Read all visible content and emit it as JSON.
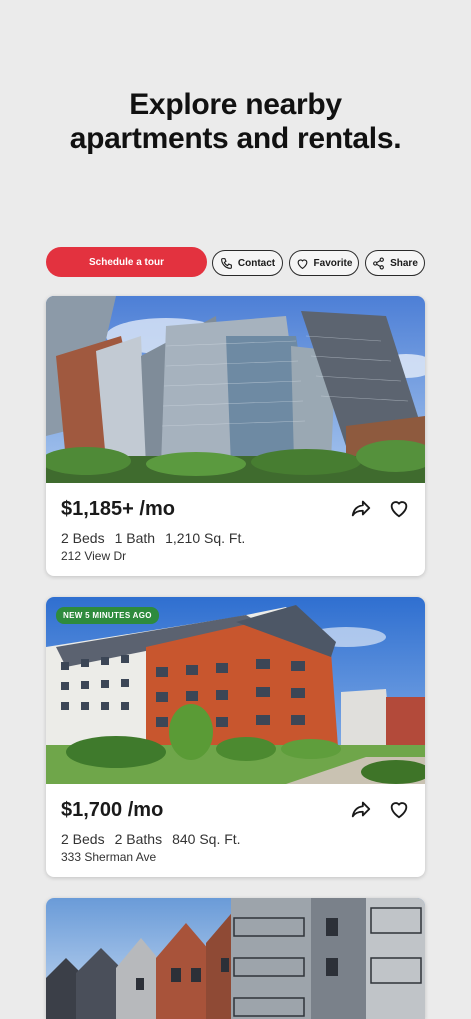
{
  "headline": {
    "line1": "Explore nearby",
    "line2": "apartments and rentals."
  },
  "actions": {
    "schedule": "Schedule a tour",
    "contact": "Contact",
    "favorite": "Favorite",
    "share": "Share"
  },
  "colors": {
    "primary": "#e3323f",
    "badge": "#2e8b3d",
    "background": "#ebebeb"
  },
  "listings": [
    {
      "price": "$1,185+ /mo",
      "beds": "2 Beds",
      "baths": "1 Bath",
      "sqft": "1,210 Sq. Ft.",
      "address": "212 View Dr",
      "badge": ""
    },
    {
      "price": "$1,700 /mo",
      "beds": "2 Beds",
      "baths": "2 Baths",
      "sqft": "840 Sq. Ft.",
      "address": "333 Sherman Ave",
      "badge": "NEW 5 MINUTES AGO"
    }
  ],
  "icons": [
    "phone-icon",
    "heart-icon",
    "share-icon",
    "forward-arrow-icon"
  ]
}
